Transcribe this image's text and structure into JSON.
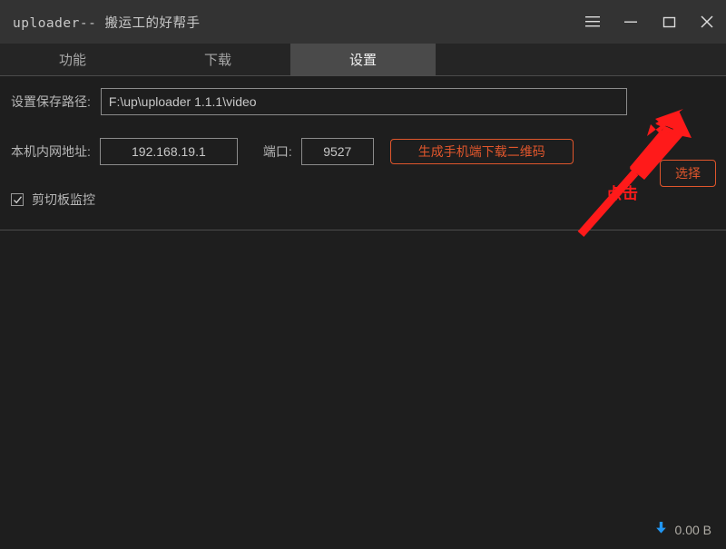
{
  "window": {
    "title": "uploader-- 搬运工的好帮手",
    "controls": [
      {
        "name": "menu-button",
        "icon": "hamburger-menu-icon"
      },
      {
        "name": "minimize-button",
        "icon": "minimize-icon"
      },
      {
        "name": "maximize-button",
        "icon": "maximize-icon"
      },
      {
        "name": "close-button",
        "icon": "close-icon"
      }
    ]
  },
  "tabs": [
    {
      "label": "功能",
      "active": false
    },
    {
      "label": "下载",
      "active": false
    },
    {
      "label": "设置",
      "active": true
    }
  ],
  "settings": {
    "save_path": {
      "label": "设置保存路径:",
      "value": "F:\\up\\uploader 1.1.1\\video",
      "placeholder": "",
      "button_label": "选择"
    },
    "network": {
      "ip_label": "本机内网地址:",
      "ip_value": "192.168.19.1",
      "port_label": "端口:",
      "port_value": "9527",
      "qr_button_label": "生成手机端下载二维码"
    },
    "clipboard": {
      "label": "剪切板监控",
      "checked": true
    }
  },
  "statusbar": {
    "download_icon": "download-arrow-icon",
    "speed": "0.00 B"
  },
  "annotation": {
    "text": "点击",
    "arrow_icon": "red-arrow-icon"
  },
  "colors": {
    "window_bg": "#1e1e1e",
    "titlebar_bg": "#333333",
    "tabbar_bg": "#252525",
    "tab_active_bg": "#4a4a4a",
    "accent_orange": "#e0562c",
    "annotation_red": "#ff1a1a",
    "status_blue": "#2196f3",
    "text_primary": "#c8c8c8",
    "text_muted": "#b6b6b6",
    "border_gray": "#8b8b8b"
  }
}
